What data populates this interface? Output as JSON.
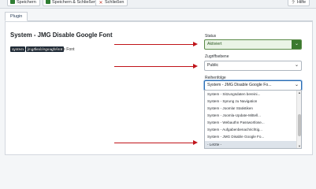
{
  "toolbar": {
    "save": "Speichern",
    "save_close": "Speichern & Schließen",
    "close": "Schließen",
    "help": "Hilfe"
  },
  "tabs": [
    "Plugin"
  ],
  "plugin": {
    "title": "System - JMG Disable Google Font",
    "badges": [
      "system",
      "jmgdisablegooglefont"
    ],
    "description": "System - JMG Disable Google Font"
  },
  "fields": {
    "status_label": "Status",
    "status_value": "Aktiviert",
    "access_label": "Zugriffsebene",
    "access_value": "Public",
    "order_label": "Reihenfolge",
    "order_value": "System - JMG Disable Google Fo..."
  },
  "order_options": [
    "System - Sitzungsdaten bereini...",
    "System - Sprung zu Navigation",
    "System - Joomla! Statistiken",
    "System - Joomla-Update-Mittell...",
    "System - Webauthn Passwortlose...",
    "System - Aufgabenbenachrichtig...",
    "System - JMG Disable Google Fo...",
    "- Letzte -"
  ],
  "order_selected_index": 7,
  "colors": {
    "arrow": "#c0141a",
    "status_green": "#3a7a2e"
  }
}
